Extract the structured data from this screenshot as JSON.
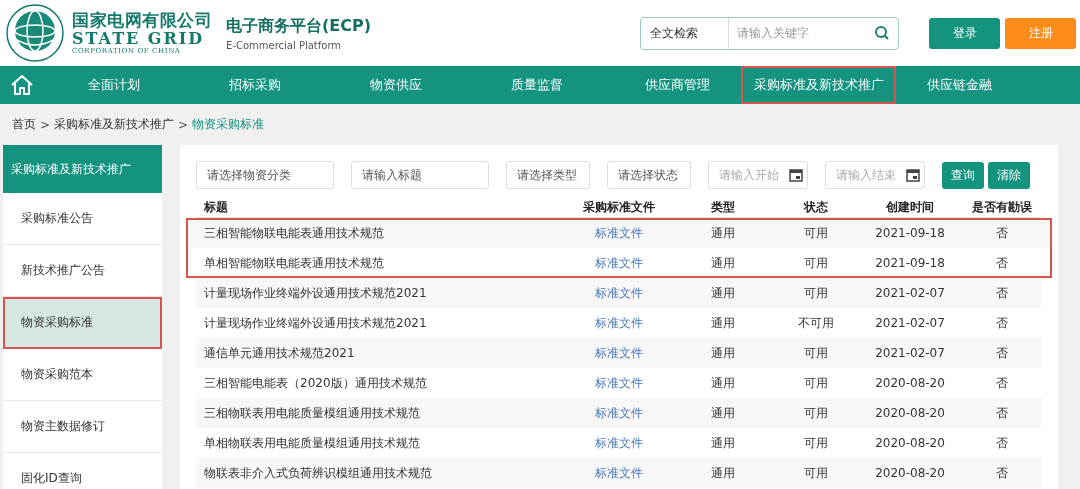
{
  "header": {
    "company_cn": "国家电网有限公司",
    "company_en": "STATE GRID",
    "company_sub": "CORPORATION OF CHINA",
    "platform_title": "电子商务平台(ECP)",
    "platform_subtitle": "E-Commercial Platform",
    "search": {
      "scope": "全文检索",
      "placeholder": "请输入关键字"
    },
    "buttons": [
      {
        "label": "登录",
        "kind": "primary"
      },
      {
        "label": "注册",
        "kind": "accent"
      }
    ]
  },
  "nav": [
    {
      "label": "全面计划",
      "selected": false
    },
    {
      "label": "招标采购",
      "selected": false
    },
    {
      "label": "物资供应",
      "selected": false
    },
    {
      "label": "质量监督",
      "selected": false
    },
    {
      "label": "供应商管理",
      "selected": false
    },
    {
      "label": "采购标准及新技术推广",
      "selected": true
    },
    {
      "label": "供应链金融",
      "selected": false
    }
  ],
  "breadcrumb": {
    "separator": ">",
    "items": [
      "首页",
      "采购标准及新技术推广",
      "物资采购标准"
    ]
  },
  "sidebar": {
    "title": "采购标准及新技术推广",
    "items": [
      {
        "label": "采购标准公告",
        "selected": false
      },
      {
        "label": "新技术推广公告",
        "selected": false
      },
      {
        "label": "物资采购标准",
        "selected": true
      },
      {
        "label": "物资采购范本",
        "selected": false
      },
      {
        "label": "物资主数据修订",
        "selected": false
      },
      {
        "label": "固化ID查询",
        "selected": false
      }
    ]
  },
  "filters": [
    {
      "kind": "select",
      "placeholder": "请选择物资分类"
    },
    {
      "kind": "text",
      "placeholder": "请输入标题"
    },
    {
      "kind": "select",
      "placeholder": "请选择类型"
    },
    {
      "kind": "select",
      "placeholder": "请选择状态"
    },
    {
      "kind": "date",
      "placeholder": "请输入开始"
    },
    {
      "kind": "date",
      "placeholder": "请输入结束"
    }
  ],
  "filter_buttons": [
    "查询",
    "清除"
  ],
  "table": {
    "columns": [
      "标题",
      "采购标准文件",
      "类型",
      "状态",
      "创建时间",
      "是否有勘误"
    ],
    "rows": [
      {
        "title": "三相智能物联电能表通用技术规范",
        "file": "标准文件",
        "type": "通用",
        "status": "可用",
        "created": "2021-09-18",
        "errata": "否",
        "highlighted": true
      },
      {
        "title": "单相智能物联电能表通用技术规范",
        "file": "标准文件",
        "type": "通用",
        "status": "可用",
        "created": "2021-09-18",
        "errata": "否",
        "highlighted": true
      },
      {
        "title": "计量现场作业终端外设通用技术规范2021",
        "file": "标准文件",
        "type": "通用",
        "status": "可用",
        "created": "2021-02-07",
        "errata": "否",
        "highlighted": false
      },
      {
        "title": "计量现场作业终端外设通用技术规范2021",
        "file": "标准文件",
        "type": "通用",
        "status": "不可用",
        "created": "2021-02-07",
        "errata": "否",
        "highlighted": false
      },
      {
        "title": "通信单元通用技术规范2021",
        "file": "标准文件",
        "type": "通用",
        "status": "可用",
        "created": "2021-02-07",
        "errata": "否",
        "highlighted": false
      },
      {
        "title": "三相智能电能表（2020版）通用技术规范",
        "file": "标准文件",
        "type": "通用",
        "status": "可用",
        "created": "2020-08-20",
        "errata": "否",
        "highlighted": false
      },
      {
        "title": "三相物联表用电能质量模组通用技术规范",
        "file": "标准文件",
        "type": "通用",
        "status": "可用",
        "created": "2020-08-20",
        "errata": "否",
        "highlighted": false
      },
      {
        "title": "单相物联表用电能质量模组通用技术规范",
        "file": "标准文件",
        "type": "通用",
        "status": "可用",
        "created": "2020-08-20",
        "errata": "否",
        "highlighted": false
      },
      {
        "title": "物联表非介入式负荷辨识模组通用技术规范",
        "file": "标准文件",
        "type": "通用",
        "status": "可用",
        "created": "2020-08-20",
        "errata": "否",
        "highlighted": false
      }
    ]
  }
}
